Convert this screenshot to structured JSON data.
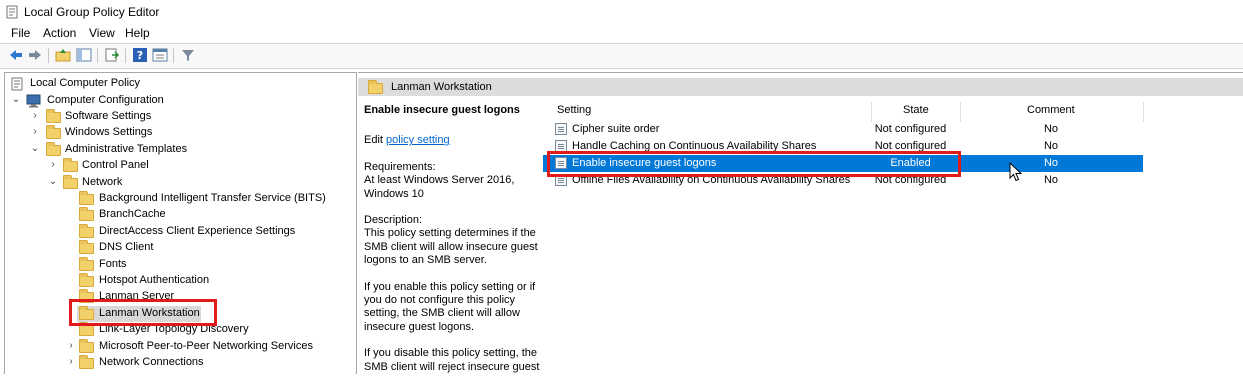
{
  "window": {
    "title": "Local Group Policy Editor"
  },
  "menu": [
    "File",
    "Action",
    "View",
    "Help"
  ],
  "tree": {
    "root": "Local Computer Policy",
    "computer_configuration": "Computer Configuration",
    "software_settings": "Software Settings",
    "windows_settings": "Windows Settings",
    "administrative_templates": "Administrative Templates",
    "control_panel": "Control Panel",
    "network": "Network",
    "network_children": [
      "Background Intelligent Transfer Service (BITS)",
      "BranchCache",
      "DirectAccess Client Experience Settings",
      "DNS Client",
      "Fonts",
      "Hotspot Authentication",
      "Lanman Server",
      "Lanman Workstation",
      "Link-Layer Topology Discovery",
      "Microsoft Peer-to-Peer Networking Services",
      "Network Connections"
    ],
    "selected": "Lanman Workstation"
  },
  "right_pane": {
    "header": "Lanman Workstation",
    "description": {
      "title": "Enable insecure guest logons",
      "edit_prefix": "Edit ",
      "edit_link": "policy setting",
      "requirements_label": "Requirements:",
      "requirements": "At least Windows Server 2016, Windows 10",
      "description_label": "Description:",
      "para1": "This policy setting determines if the SMB client will allow insecure guest logons to an SMB server.",
      "para2": "If you enable this policy setting or if you do not configure this policy setting, the SMB client will allow insecure guest logons.",
      "para3": "If you disable this policy setting, the SMB client will reject insecure guest"
    },
    "columns": {
      "setting": "Setting",
      "state": "State",
      "comment": "Comment"
    },
    "rows": [
      {
        "name": "Cipher suite order",
        "state": "Not configured",
        "comment": "No"
      },
      {
        "name": "Handle Caching on Continuous Availability Shares",
        "state": "Not configured",
        "comment": "No"
      },
      {
        "name": "Enable insecure guest logons",
        "state": "Enabled",
        "comment": "No"
      },
      {
        "name": "Offline Files Availability on Continuous Availability Shares",
        "state": "Not configured",
        "comment": "No"
      }
    ]
  },
  "colors": {
    "selection": "#0078d7",
    "highlight_box": "#e01b1b",
    "link": "#0066cc",
    "folder": "#f2d16b"
  }
}
